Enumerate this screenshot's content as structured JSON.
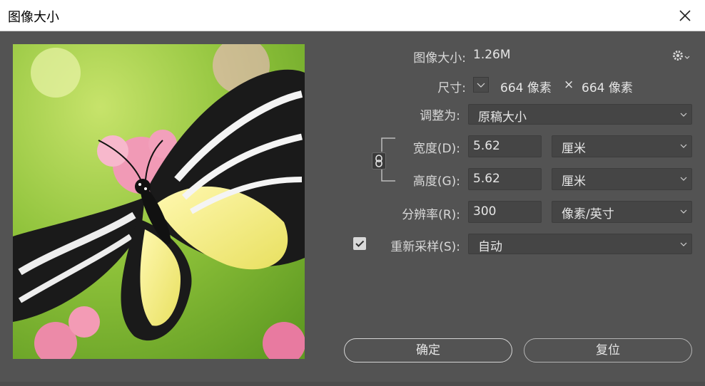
{
  "window": {
    "title": "图像大小"
  },
  "info": {
    "size_label": "图像大小:",
    "size_value": "1.26M",
    "dimensions_label": "尺寸:",
    "width_px": "664 像素",
    "times": "×",
    "height_px": "664 像素"
  },
  "fit_to": {
    "label": "调整为:",
    "value": "原稿大小"
  },
  "width": {
    "label": "宽度(D):",
    "value": "5.62",
    "unit": "厘米"
  },
  "height": {
    "label": "高度(G):",
    "value": "5.62",
    "unit": "厘米"
  },
  "resolution": {
    "label": "分辨率(R):",
    "value": "300",
    "unit": "像素/英寸"
  },
  "resample": {
    "label": "重新采样(S):",
    "checked": true,
    "value": "自动"
  },
  "buttons": {
    "ok": "确定",
    "reset": "复位"
  },
  "icons": {
    "close": "close-icon",
    "gear": "gear-icon",
    "link": "link-chain-icon",
    "chevron": "chevron-down-icon",
    "checkmark": "checkmark-icon"
  },
  "colors": {
    "dialog_bg": "#535353",
    "field_bg": "#454545",
    "title_bg": "#ffffff"
  }
}
